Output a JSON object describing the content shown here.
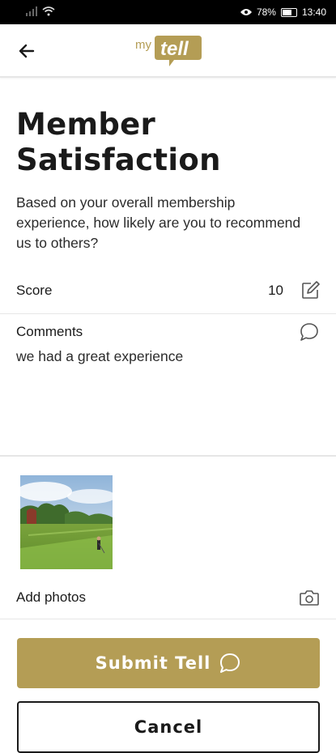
{
  "status_bar": {
    "battery": "78%",
    "time": "13:40",
    "icons": [
      "signal-icon",
      "wifi-icon",
      "eye-icon",
      "battery-icon"
    ]
  },
  "app_bar": {
    "logo_prefix": "my",
    "logo_word": "tell",
    "back_icon": "arrow-left-icon"
  },
  "survey": {
    "title": "Member Satisfaction",
    "question": "Based on your overall membership experience, how likely are you to recommend us to others?"
  },
  "score": {
    "label": "Score",
    "value": "10",
    "icon": "edit-icon"
  },
  "comments": {
    "label": "Comments",
    "text": "we had a great experience",
    "icon": "speech-bubble-icon"
  },
  "photos": {
    "add_label": "Add photos",
    "icon": "camera-icon"
  },
  "actions": {
    "submit_label": "Submit Tell",
    "cancel_label": "Cancel"
  },
  "colors": {
    "accent": "#b49d55",
    "status_bar": "#000000",
    "divider": "#e6e6e6"
  }
}
